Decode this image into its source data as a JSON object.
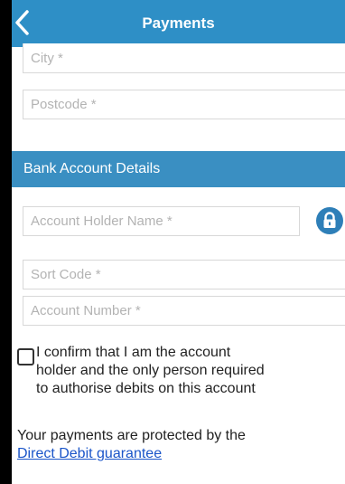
{
  "header": {
    "title": "Payments",
    "back_icon": "chevron-left-icon",
    "color": "#2e8fc6"
  },
  "address": {
    "city_placeholder": "City *",
    "postcode_placeholder": "Postcode *"
  },
  "bank": {
    "section_title": "Bank Account Details",
    "section_color": "#3a8fc2",
    "holder_placeholder": "Account Holder Name *",
    "lock_icon": "lock-icon",
    "sort_code_placeholder": "Sort Code *",
    "account_number_placeholder": "Account Number *"
  },
  "confirm": {
    "checked": false,
    "line1": "I confirm that I am the account",
    "line2": "holder and the only person required",
    "line3": "to authorise debits on this account"
  },
  "guarantee": {
    "text": "Your payments are protected by the",
    "link_text": "Direct Debit guarantee",
    "link_color": "#1a55c9"
  }
}
